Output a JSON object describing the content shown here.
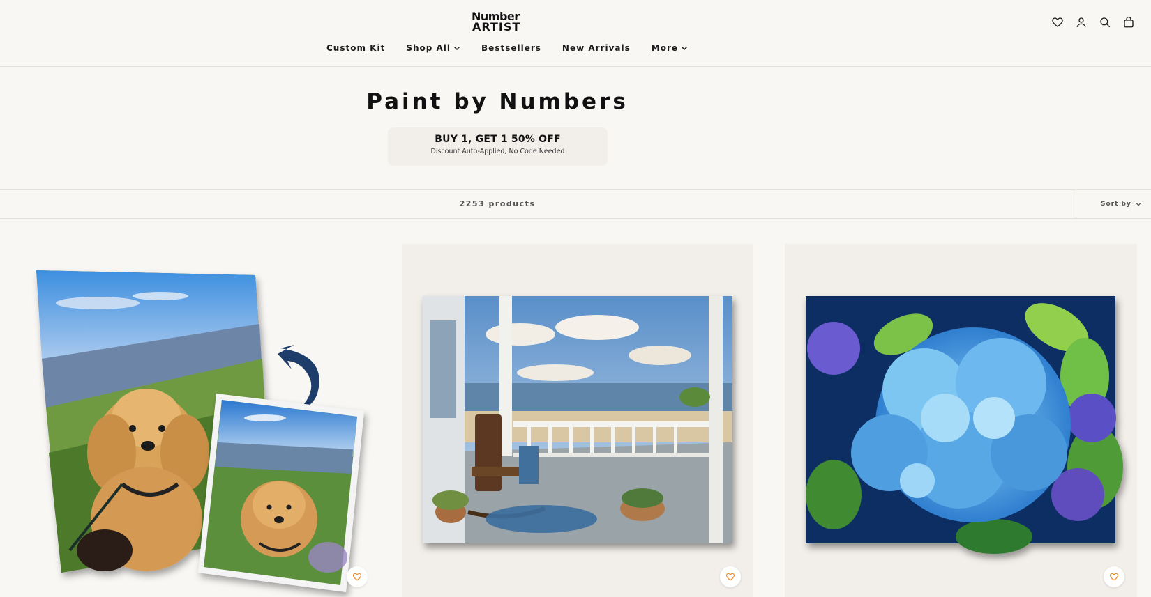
{
  "brand": {
    "logo_line1": "Number",
    "logo_line2": "ARTIST"
  },
  "header_icons": [
    "heart-icon",
    "account-icon",
    "search-icon",
    "bag-icon"
  ],
  "nav": [
    {
      "label": "Custom Kit",
      "dropdown": false
    },
    {
      "label": "Shop All",
      "dropdown": true
    },
    {
      "label": "Bestsellers",
      "dropdown": false
    },
    {
      "label": "New Arrivals",
      "dropdown": false
    },
    {
      "label": "More",
      "dropdown": true
    }
  ],
  "page": {
    "title": "Paint by Numbers"
  },
  "promo": {
    "headline": "BUY 1, GET 1 50% OFF",
    "subtext": "Discount Auto-Applied, No Code Needed"
  },
  "toolbar": {
    "product_count": "2253 products",
    "sort_label": "Sort by"
  },
  "products": [
    {
      "image": "custom pet portrait canvas of a curly dog on a grassy hill"
    },
    {
      "image": "seaside porch with rocking chair overlooking the beach"
    },
    {
      "image": "blue hydrangea flowers with green leaves"
    }
  ],
  "colors": {
    "background": "#f9f7f4",
    "card_bg": "#f2eeea",
    "accent": "#f08a24",
    "text": "#1b1b1b"
  }
}
